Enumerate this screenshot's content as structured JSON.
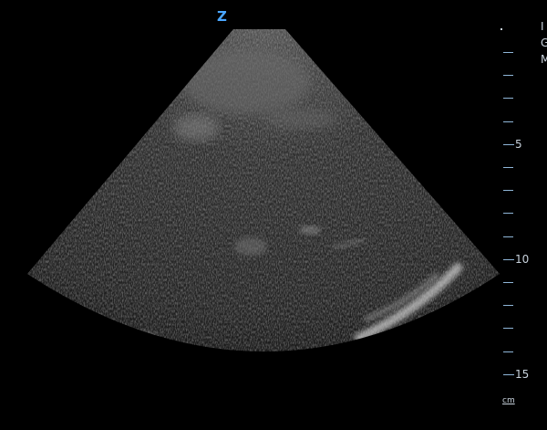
{
  "orientation_marker": {
    "glyph": "Z",
    "color": "#4aa6ff"
  },
  "depth_scale": {
    "unit": "cm",
    "labels": [
      "5",
      "10",
      "15"
    ]
  },
  "side_text": [
    "I",
    "G",
    "M"
  ],
  "colors": {
    "background": "#000000",
    "scale": "#8fb6d8"
  }
}
